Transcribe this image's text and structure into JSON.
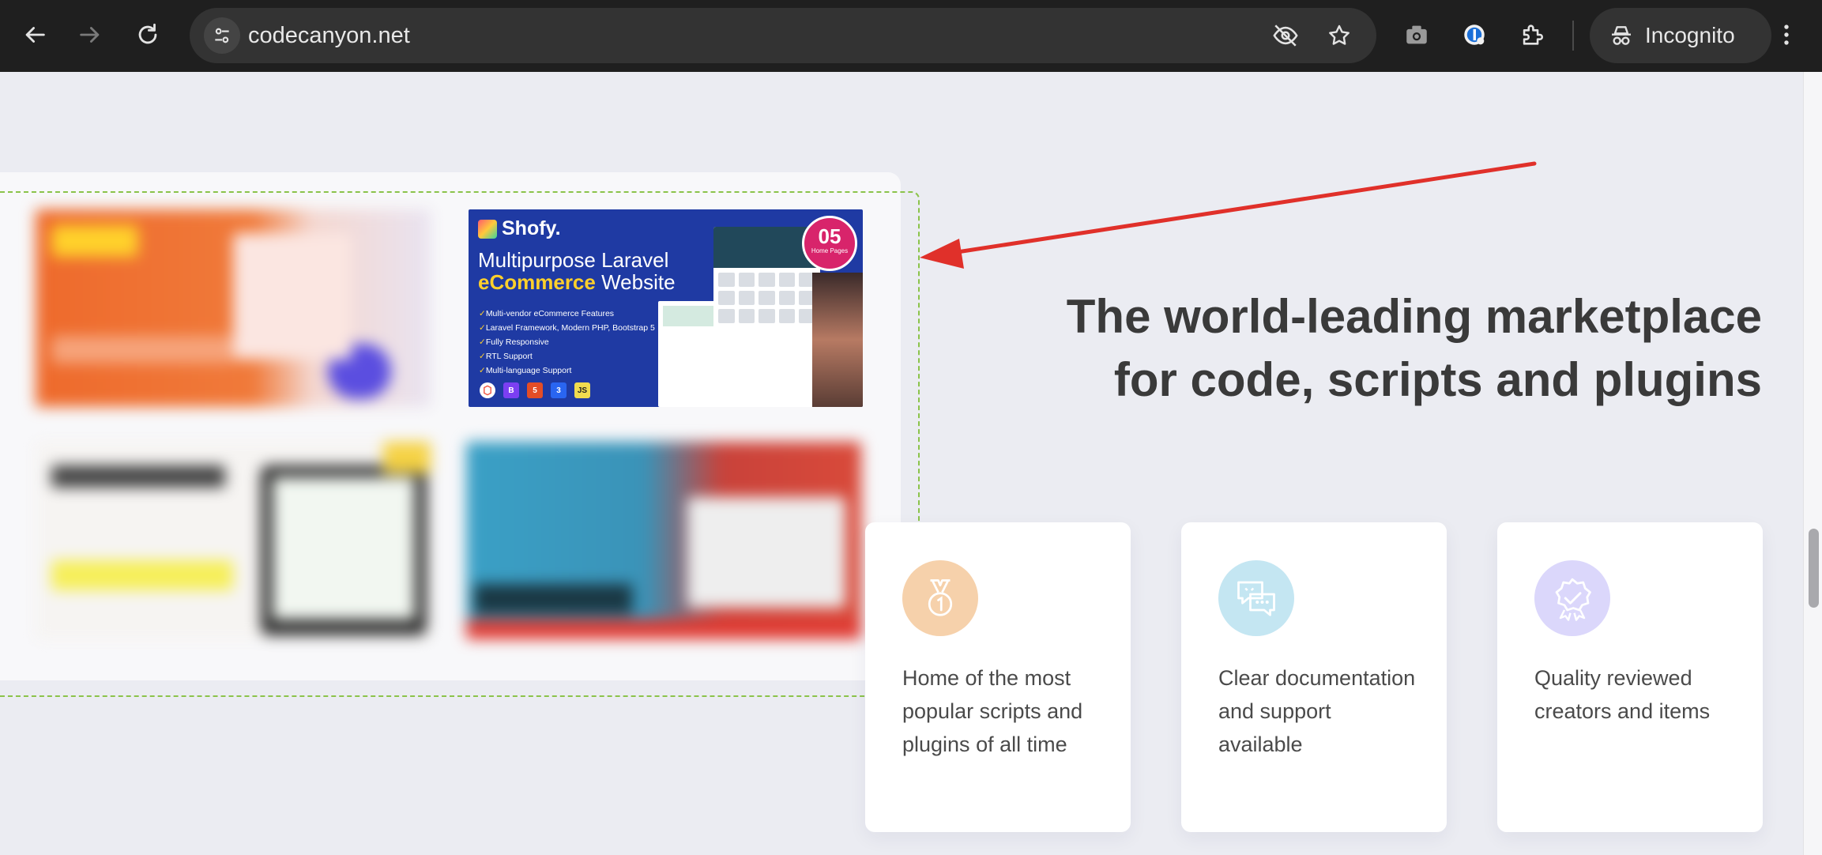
{
  "browser": {
    "url": "codecanyon.net",
    "incognito_label": "Incognito"
  },
  "showcase": {
    "featured": {
      "brand": "Shofy.",
      "headline_line1": "Multipurpose Laravel",
      "headline_highlight": "eCommerce",
      "headline_rest": " Website",
      "features": [
        "Multi-vendor eCommerce Features",
        "Laravel Framework, Modern PHP, Bootstrap 5",
        "Fully Responsive",
        "RTL Support",
        "Multi-language Support"
      ],
      "badge_number": "05",
      "badge_label": "Home Pages",
      "tech_badges": [
        "B",
        "5",
        "3",
        "JS"
      ]
    }
  },
  "hero": {
    "title": "The world-leading marketplace for code, scripts and plugins"
  },
  "cards": [
    {
      "icon": "medal-icon",
      "text": "Home of the most popular scripts and plugins of all time"
    },
    {
      "icon": "chat-support-icon",
      "text": "Clear documentation and support available"
    },
    {
      "icon": "quality-badge-icon",
      "text": "Quality reviewed creators and items"
    }
  ],
  "colors": {
    "annotation_arrow": "#e0302a",
    "dashed_outline": "#8bc34a",
    "page_background": "#ebecf2"
  }
}
